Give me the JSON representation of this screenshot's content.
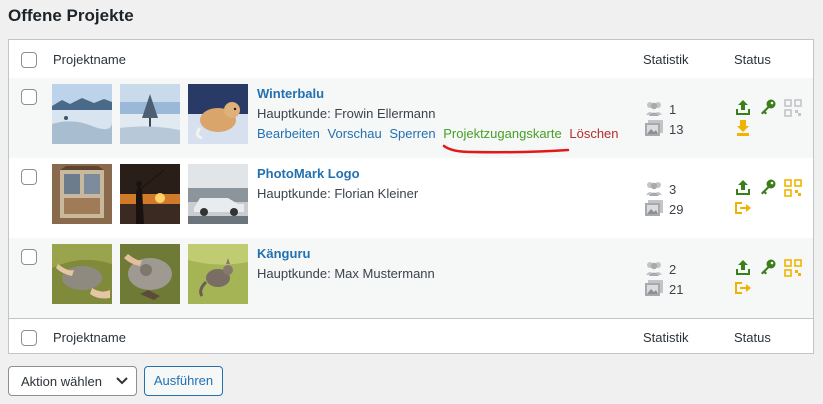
{
  "page": {
    "title": "Offene Projekte"
  },
  "table": {
    "headers": {
      "name": "Projektname",
      "stats": "Statistik",
      "status": "Status"
    },
    "footers": {
      "name": "Projektname",
      "stats": "Statistik",
      "status": "Status"
    },
    "rows": [
      {
        "title": "Winterbalu",
        "client": "Hauptkunde: Frowin Ellermann",
        "actions": [
          "Bearbeiten",
          "Vorschau",
          "Sperren",
          "Projektzugangskarte",
          "Löschen"
        ],
        "visitors": "1",
        "images": "13",
        "thumbs": [
          "snow-field-photo",
          "snow-tree-photo",
          "dog-in-snow-photo"
        ]
      },
      {
        "title": "PhotoMark Logo",
        "client": "Hauptkunde: Florian Kleiner",
        "actions": [],
        "visitors": "3",
        "images": "29",
        "thumbs": [
          "window-photo",
          "sunset-fisher-photo",
          "car-lake-photo"
        ]
      },
      {
        "title": "Känguru",
        "client": "Hauptkunde: Max Mustermann",
        "actions": [],
        "visitors": "2",
        "images": "21",
        "thumbs": [
          "kangaroo-hands-photo",
          "kangaroo-pouch-photo",
          "kangaroo-grass-photo"
        ]
      }
    ]
  },
  "bulk": {
    "select_label": "Aktion wählen",
    "apply_label": "Ausführen"
  },
  "colors": {
    "link": "#2271b1",
    "green": "#46a024",
    "red": "#b32d2e",
    "status_green": "#3a7f1b",
    "status_yellow": "#f0b400"
  }
}
